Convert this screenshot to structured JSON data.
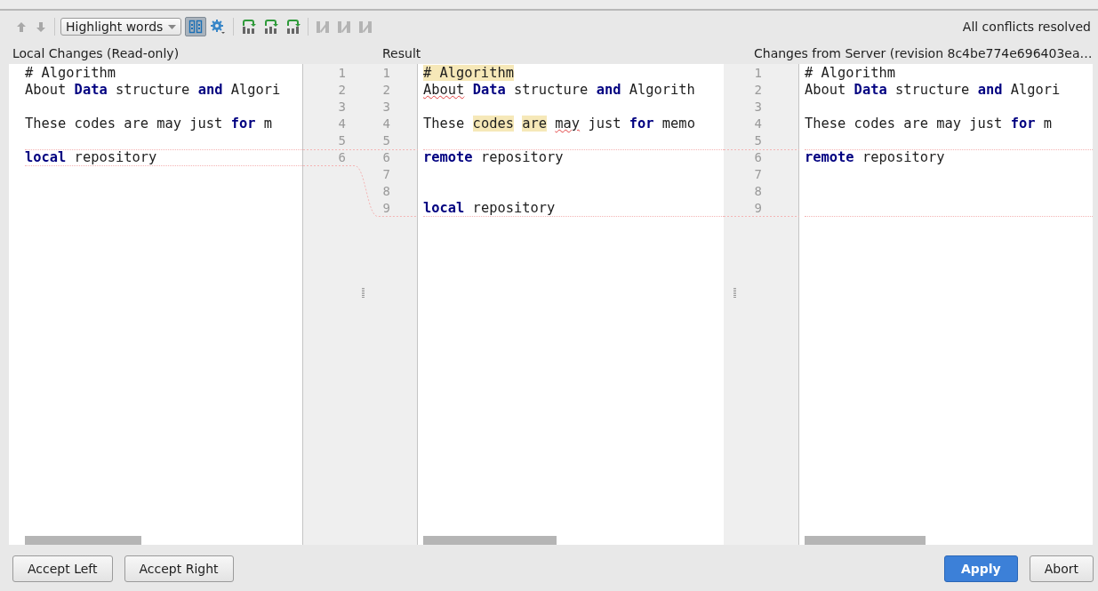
{
  "toolbar": {
    "nav_buttons": [
      {
        "kind": "up",
        "disabled": true
      },
      {
        "kind": "down",
        "disabled": true
      }
    ],
    "highlight_dropdown": {
      "value": "Highlight words"
    },
    "sync_scroll_toggle": {
      "selected": true
    },
    "apply_buttons": [
      {
        "disabled": false
      },
      {
        "disabled": false
      },
      {
        "disabled": false
      }
    ],
    "resolve_buttons": [
      {
        "disabled": true
      },
      {
        "disabled": true
      },
      {
        "disabled": true
      }
    ],
    "status": "All conflicts resolved"
  },
  "panes": [
    {
      "title": "Local Changes (Read-only)",
      "lines": [
        {
          "number": "1",
          "tokens": [
            {
              "kind": "plain",
              "text": "# Algorithm"
            }
          ]
        },
        {
          "number": "2",
          "tokens": [
            {
              "kind": "plain",
              "text": "About "
            },
            {
              "kind": "keyword",
              "text": "Data"
            },
            {
              "kind": "plain",
              "text": " structure "
            },
            {
              "kind": "keyword",
              "text": "and"
            },
            {
              "kind": "plain",
              "text": " Algori"
            }
          ]
        },
        {
          "number": "3"
        },
        {
          "number": "4",
          "tokens": [
            {
              "kind": "plain",
              "text": "These codes are may just "
            },
            {
              "kind": "keyword",
              "text": "for"
            },
            {
              "kind": "plain",
              "text": " m"
            }
          ]
        },
        {
          "number": "5"
        },
        {
          "number": "6",
          "changed": true,
          "tokens": [
            {
              "kind": "keyword",
              "text": "local"
            },
            {
              "kind": "plain",
              "text": " repository"
            }
          ]
        }
      ]
    },
    {
      "title": "Result",
      "lines": [
        {
          "number": "1",
          "tokens": [
            {
              "kind": "highlight",
              "text": "# Algorithm"
            }
          ]
        },
        {
          "number": "2",
          "tokens": [
            {
              "kind": "typo",
              "text": "About",
              "space_after": true
            },
            {
              "kind": "keyword",
              "text": "Data"
            },
            {
              "kind": "plain",
              "text": " structure "
            },
            {
              "kind": "keyword",
              "text": "and"
            },
            {
              "kind": "plain",
              "text": " Algorith"
            }
          ]
        },
        {
          "number": "3"
        },
        {
          "number": "4",
          "tokens": [
            {
              "kind": "plain",
              "text": "These "
            },
            {
              "kind": "highlight",
              "text": "codes",
              "space_after": true
            },
            {
              "kind": "highlight",
              "text": "are",
              "space_after": true
            },
            {
              "kind": "typo",
              "text": "may"
            },
            {
              "kind": "plain",
              "text": " just "
            },
            {
              "kind": "keyword",
              "text": "for"
            },
            {
              "kind": "plain",
              "text": " memo"
            }
          ]
        },
        {
          "number": "5"
        },
        {
          "number": "6",
          "changed": true,
          "tokens": [
            {
              "kind": "keyword",
              "text": "remote"
            },
            {
              "kind": "plain",
              "text": " repository"
            }
          ]
        },
        {
          "number": "7",
          "changed": true
        },
        {
          "number": "8",
          "changed": true
        },
        {
          "number": "9",
          "changed": true,
          "tokens": [
            {
              "kind": "keyword",
              "text": "local"
            },
            {
              "kind": "plain",
              "text": " repository"
            }
          ]
        }
      ]
    },
    {
      "title": "Changes from Server (revision 8c4be774e696403ea…",
      "lines": [
        {
          "number": "1",
          "tokens": [
            {
              "kind": "plain",
              "text": "# Algorithm"
            }
          ]
        },
        {
          "number": "2",
          "tokens": [
            {
              "kind": "plain",
              "text": "About "
            },
            {
              "kind": "keyword",
              "text": "Data"
            },
            {
              "kind": "plain",
              "text": " structure "
            },
            {
              "kind": "keyword",
              "text": "and"
            },
            {
              "kind": "plain",
              "text": " Algori"
            }
          ]
        },
        {
          "number": "3"
        },
        {
          "number": "4",
          "tokens": [
            {
              "kind": "plain",
              "text": "These codes are may just "
            },
            {
              "kind": "keyword",
              "text": "for"
            },
            {
              "kind": "plain",
              "text": " m"
            }
          ]
        },
        {
          "number": "5"
        },
        {
          "number": "6",
          "changed": true,
          "tokens": [
            {
              "kind": "keyword",
              "text": "remote"
            },
            {
              "kind": "plain",
              "text": " repository"
            }
          ]
        },
        {
          "number": "7",
          "changed": true
        },
        {
          "number": "8",
          "changed": true
        },
        {
          "number": "9",
          "changed": true
        }
      ]
    }
  ],
  "buttons": [
    {
      "label": "Accept Left",
      "kind": "default"
    },
    {
      "label": "Accept Right",
      "kind": "default"
    },
    {
      "label": "Apply",
      "kind": "primary"
    },
    {
      "label": "Abort",
      "kind": "default"
    }
  ]
}
